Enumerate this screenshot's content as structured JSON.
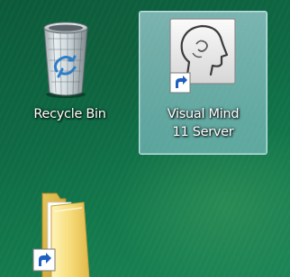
{
  "desktop": {
    "icons": [
      {
        "label_lines": [
          "Recycle Bin"
        ],
        "icon": "recycle-bin-icon",
        "selected": false,
        "shortcut": false
      },
      {
        "label_lines": [
          "Visual Mind",
          "11 Server"
        ],
        "icon": "head-profile-icon",
        "selected": true,
        "shortcut": true
      },
      {
        "label_lines": [],
        "icon": "folder-icon",
        "selected": false,
        "shortcut": true
      }
    ]
  }
}
